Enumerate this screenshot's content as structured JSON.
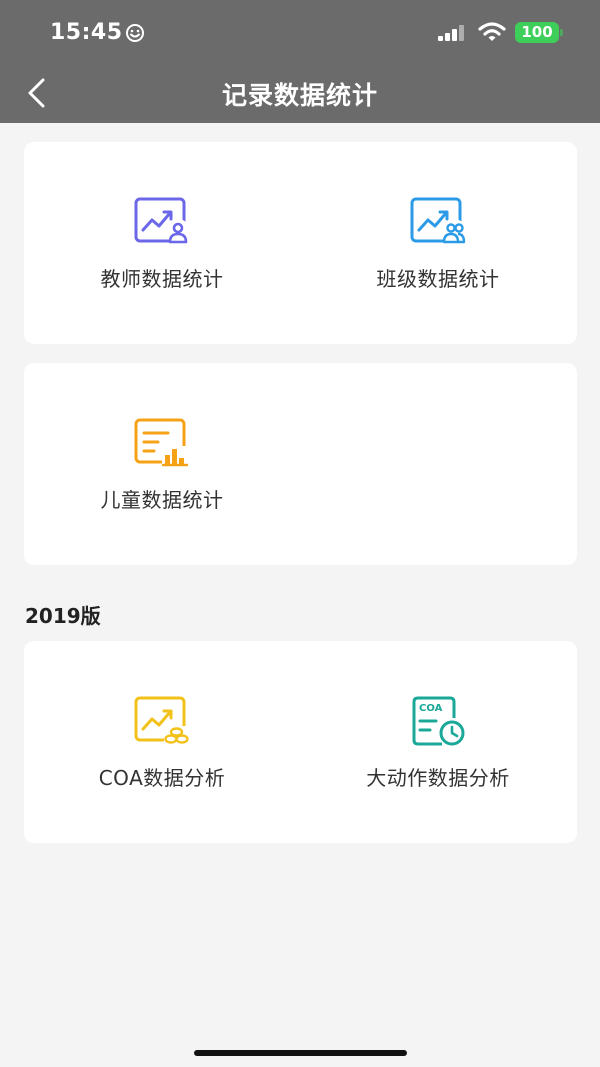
{
  "status_bar": {
    "time": "15:45",
    "battery": "100"
  },
  "nav": {
    "title": "记录数据统计",
    "back_icon": "chevron-left-icon"
  },
  "cards": [
    {
      "tiles": [
        {
          "label": "教师数据统计",
          "icon": "teacher-stats-icon",
          "color": "#6b67e8"
        },
        {
          "label": "班级数据统计",
          "icon": "class-stats-icon",
          "color": "#2b9be8"
        }
      ]
    },
    {
      "tiles": [
        {
          "label": "儿童数据统计",
          "icon": "child-stats-icon",
          "color": "#f5a216"
        }
      ]
    },
    {
      "section_title": "2019版",
      "tiles": [
        {
          "label": "COA数据分析",
          "icon": "coa-analysis-icon",
          "color": "#f2c21b"
        },
        {
          "label": "大动作数据分析",
          "icon": "gross-motor-analysis-icon",
          "color": "#1aa899",
          "icon_text": "COA"
        }
      ]
    }
  ],
  "colors": {
    "header_bg": "#6b6b6b",
    "page_bg": "#f4f4f4",
    "card_bg": "#ffffff",
    "battery": "#3ecf5a"
  }
}
